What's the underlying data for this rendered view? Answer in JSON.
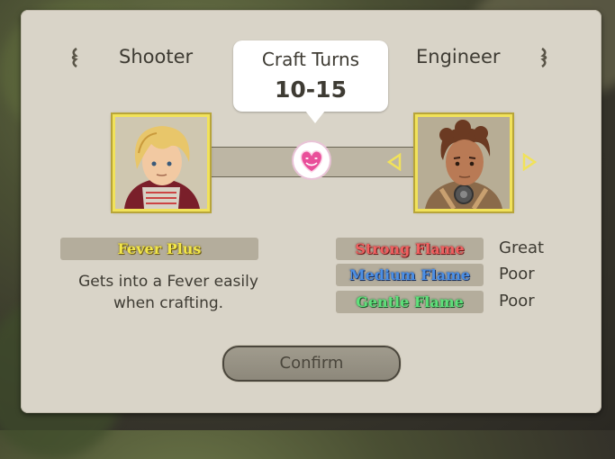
{
  "header": {
    "left_job": "Shooter",
    "right_job": "Engineer"
  },
  "craft": {
    "title": "Craft Turns",
    "value": "10-15"
  },
  "skill": {
    "name": "Fever Plus",
    "description_line1": "Gets into a Fever easily",
    "description_line2": "when crafting."
  },
  "flames": [
    {
      "name": "Strong Flame",
      "rating": "Great",
      "color": "#e84a4a"
    },
    {
      "name": "Medium Flame",
      "rating": "Poor",
      "color": "#3b7fd6"
    },
    {
      "name": "Gentle Flame",
      "rating": "Poor",
      "color": "#3fc85a"
    }
  ],
  "buttons": {
    "confirm": "Confirm"
  },
  "icons": {
    "left_bracket": "bracket-left-icon",
    "right_bracket": "bracket-right-icon",
    "heart": "heart-affinity-icon",
    "arrow_left": "arrow-left-icon",
    "arrow_right": "arrow-right-icon"
  },
  "colors": {
    "panel": "#d9d4c8",
    "portrait_border": "#f1e25a",
    "skill_name": "#f2e64a"
  }
}
